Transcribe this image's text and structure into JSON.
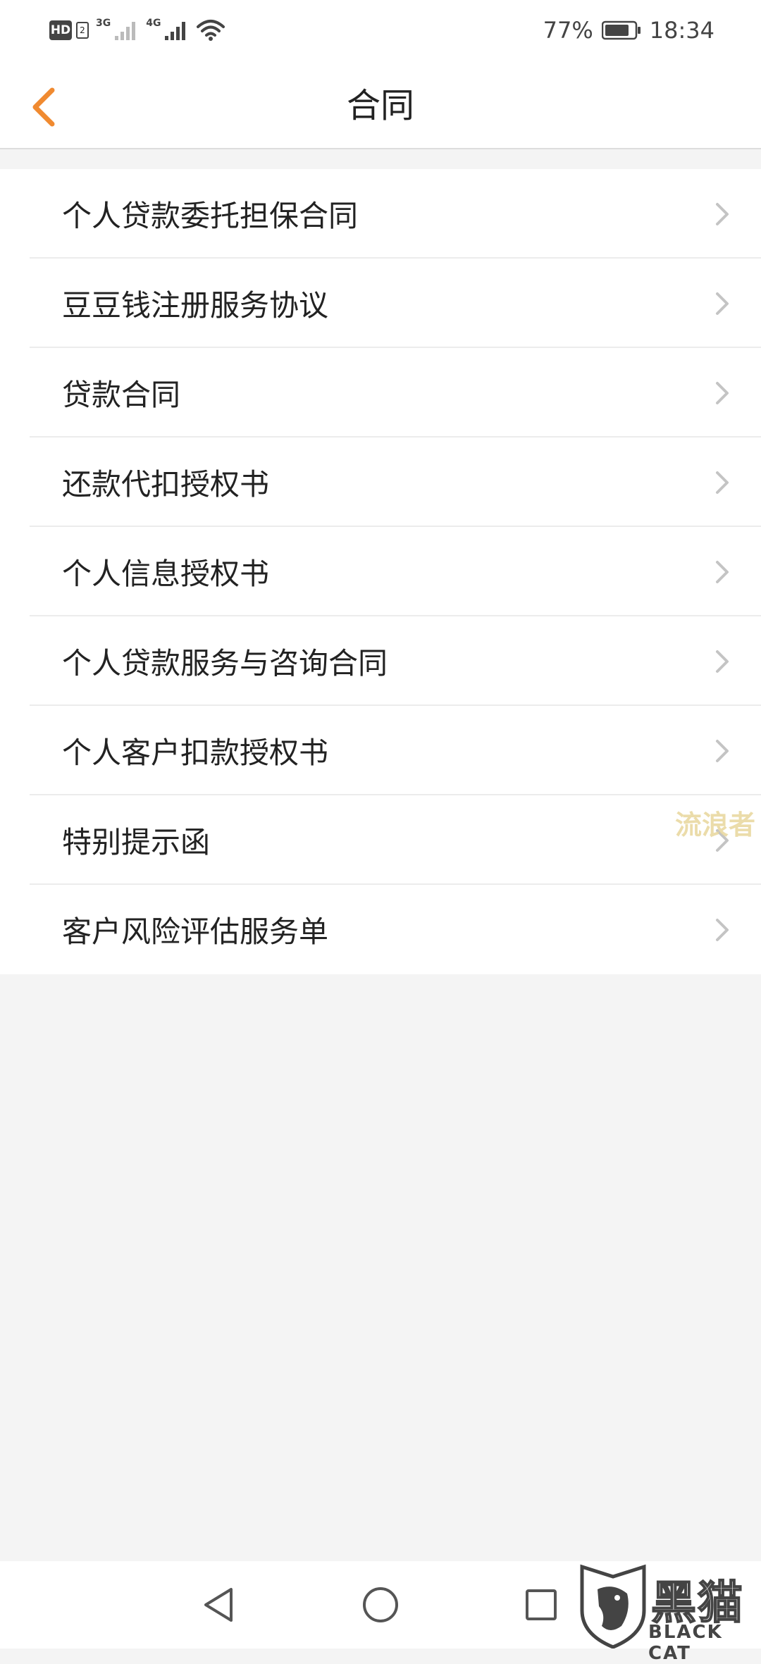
{
  "status_bar": {
    "hd": "HD",
    "hd_sub": "2",
    "network_1": "3G",
    "network_2": "4G",
    "battery_percent": "77%",
    "time": "18:34"
  },
  "header": {
    "title": "合同"
  },
  "contracts": {
    "items": [
      {
        "label": "个人贷款委托担保合同"
      },
      {
        "label": "豆豆钱注册服务协议"
      },
      {
        "label": "贷款合同"
      },
      {
        "label": "还款代扣授权书"
      },
      {
        "label": "个人信息授权书"
      },
      {
        "label": "个人贷款服务与咨询合同"
      },
      {
        "label": "个人客户扣款授权书"
      },
      {
        "label": "特别提示函"
      },
      {
        "label": "客户风险评估服务单"
      }
    ]
  },
  "watermark": {
    "text": "流浪者"
  },
  "logo": {
    "cn": "黑猫",
    "en": "BLACK CAT"
  },
  "colors": {
    "accent": "#f08a30",
    "background": "#f4f4f4",
    "chevron": "#c4c4c4"
  }
}
